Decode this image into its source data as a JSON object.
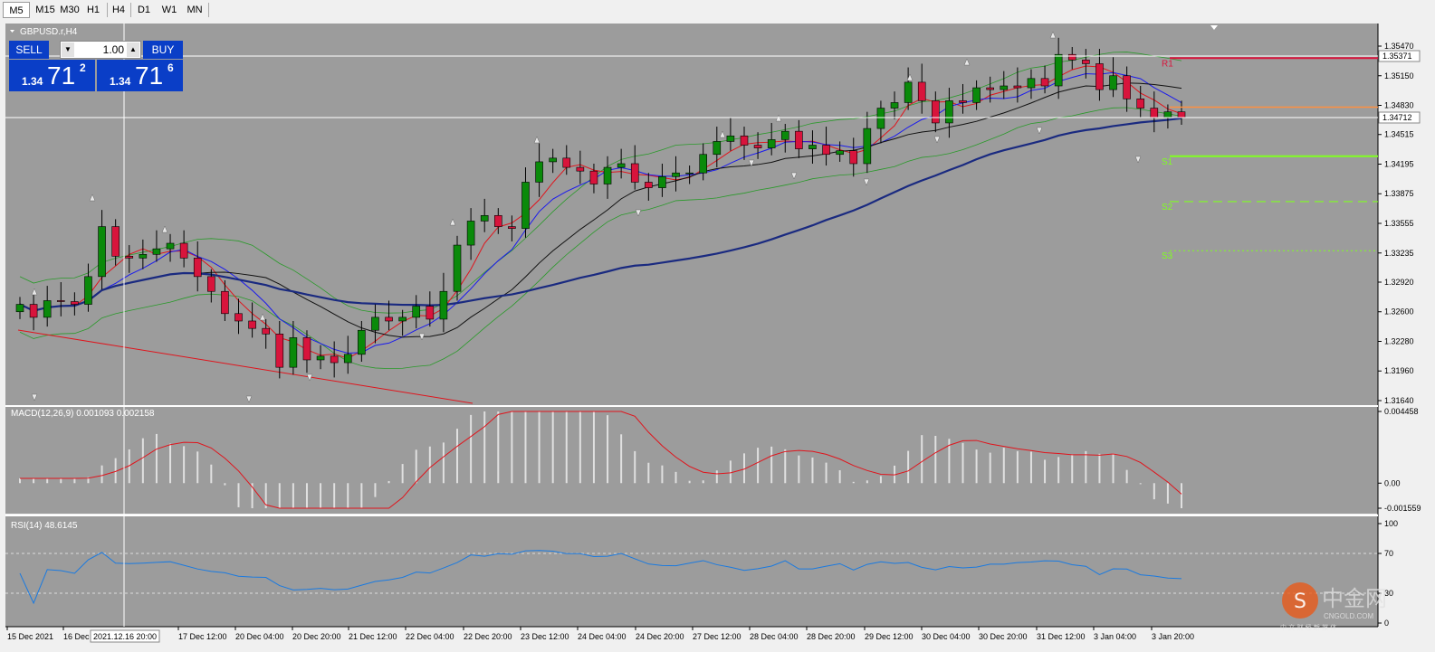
{
  "timeframes": [
    "M5",
    "M15",
    "M30",
    "H1",
    "H4",
    "D1",
    "W1",
    "MN"
  ],
  "active_timeframe": "M5",
  "chart": {
    "title": "GBPUSD.r,H4",
    "price_axis_labels": [
      "1.35470",
      "1.35150",
      "1.34830",
      "1.34515",
      "1.34195",
      "1.33875",
      "1.33555",
      "1.33235",
      "1.32920",
      "1.32600",
      "1.32280",
      "1.31960",
      "1.31640"
    ],
    "price_axis_range": [
      1.3164,
      1.3547
    ],
    "marker_upper": "1.35371",
    "marker_current": "1.34712",
    "pivot_labels": [
      "R1",
      "S1",
      "S2",
      "S3"
    ],
    "pivot_levels": {
      "R1": 1.3534,
      "orange": 1.3481,
      "S1": 1.3428,
      "S2": 1.3379,
      "S3": 1.3326
    },
    "time_axis_labels": [
      "15 Dec 2021",
      "16 Dec",
      "17 Dec 12:00",
      "20 Dec 04:00",
      "20 Dec 20:00",
      "21 Dec 12:00",
      "22 Dec 04:00",
      "22 Dec 20:00",
      "23 Dec 12:00",
      "24 Dec 04:00",
      "24 Dec 20:00",
      "27 Dec 12:00",
      "28 Dec 04:00",
      "28 Dec 20:00",
      "29 Dec 12:00",
      "30 Dec 04:00",
      "30 Dec 20:00",
      "31 Dec 12:00",
      "3 Jan 04:00",
      "3 Jan 20:00"
    ],
    "crosshair_time": "2021.12.16 20:00"
  },
  "macd": {
    "title": "MACD(12,26,9) 0.001093 0.002158",
    "axis_labels": [
      "0.004458",
      "0.00",
      "-0.001559"
    ],
    "range": [
      -0.001559,
      0.004458
    ]
  },
  "rsi": {
    "title": "RSI(14) 48.6145",
    "axis_labels": [
      "100",
      "70",
      "30",
      "0"
    ]
  },
  "trade_panel": {
    "sell_label": "SELL",
    "buy_label": "BUY",
    "lot": "1.00",
    "sell_prefix": "1.34",
    "sell_big": "71",
    "sell_sup": "2",
    "buy_prefix": "1.34",
    "buy_big": "71",
    "buy_sup": "6"
  },
  "watermark": {
    "brand": "中金网",
    "site": "CNGOLD.COM",
    "tagline": "中 文 财 经 新 媒 体"
  },
  "colors": {
    "background": "#9c9c9c",
    "bull": "#0a8a0a",
    "bear": "#d8143c",
    "grid_panel_sep": "#ffffff"
  }
}
